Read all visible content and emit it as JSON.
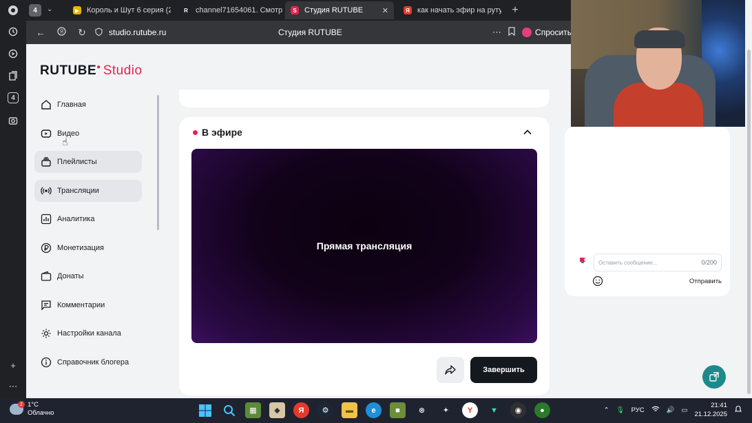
{
  "browser": {
    "tab_count": "4",
    "tabs": [
      {
        "label": "Король и Шут 6 серия (20",
        "fav_color": "#e8b400",
        "fav_glyph": "▶"
      },
      {
        "label": "channel71654061. Смотр",
        "fav_color": "#1f1f2b",
        "fav_glyph": "R"
      },
      {
        "label": "Студия RUTUBE",
        "fav_color": "#e6224f",
        "fav_glyph": "S",
        "active": true
      },
      {
        "label": "как начать эфир на рутуб",
        "fav_color": "#e33a2c",
        "fav_glyph": "Я"
      }
    ],
    "url": "studio.rutube.ru",
    "page_title": "Студия RUTUBE",
    "ask_label": "Спросить"
  },
  "studio": {
    "logo_brand": "RUTUBE",
    "logo_product": "Studio",
    "sidebar": [
      {
        "label": "Главная",
        "icon": "home-icon"
      },
      {
        "label": "Видео",
        "icon": "video-icon"
      },
      {
        "label": "Плейлисты",
        "icon": "playlist-icon"
      },
      {
        "label": "Трансляции",
        "icon": "broadcast-icon"
      },
      {
        "label": "Аналитика",
        "icon": "analytics-icon"
      },
      {
        "label": "Монетизация",
        "icon": "ruble-icon"
      },
      {
        "label": "Донаты",
        "icon": "wallet-icon"
      },
      {
        "label": "Комментарии",
        "icon": "comment-icon"
      },
      {
        "label": "Настройки канала",
        "icon": "gear-icon"
      },
      {
        "label": "Справочник блогера",
        "icon": "info-icon"
      }
    ],
    "live_section_title": "В эфире",
    "player_label": "Прямая трансляция",
    "finish_button": "Завершить",
    "chat": {
      "placeholder": "Оставить сообщение...",
      "counter": "0/200",
      "send_label": "Отправить"
    }
  },
  "taskbar": {
    "weather_temp": "1°C",
    "weather_desc": "Облачно",
    "weather_badge": "2",
    "language": "РУС",
    "time": "21:41",
    "date": "21.12.2025"
  },
  "colors": {
    "accent": "#e6224f",
    "dark_button": "#14191f",
    "float_button": "#1c8a8a"
  }
}
